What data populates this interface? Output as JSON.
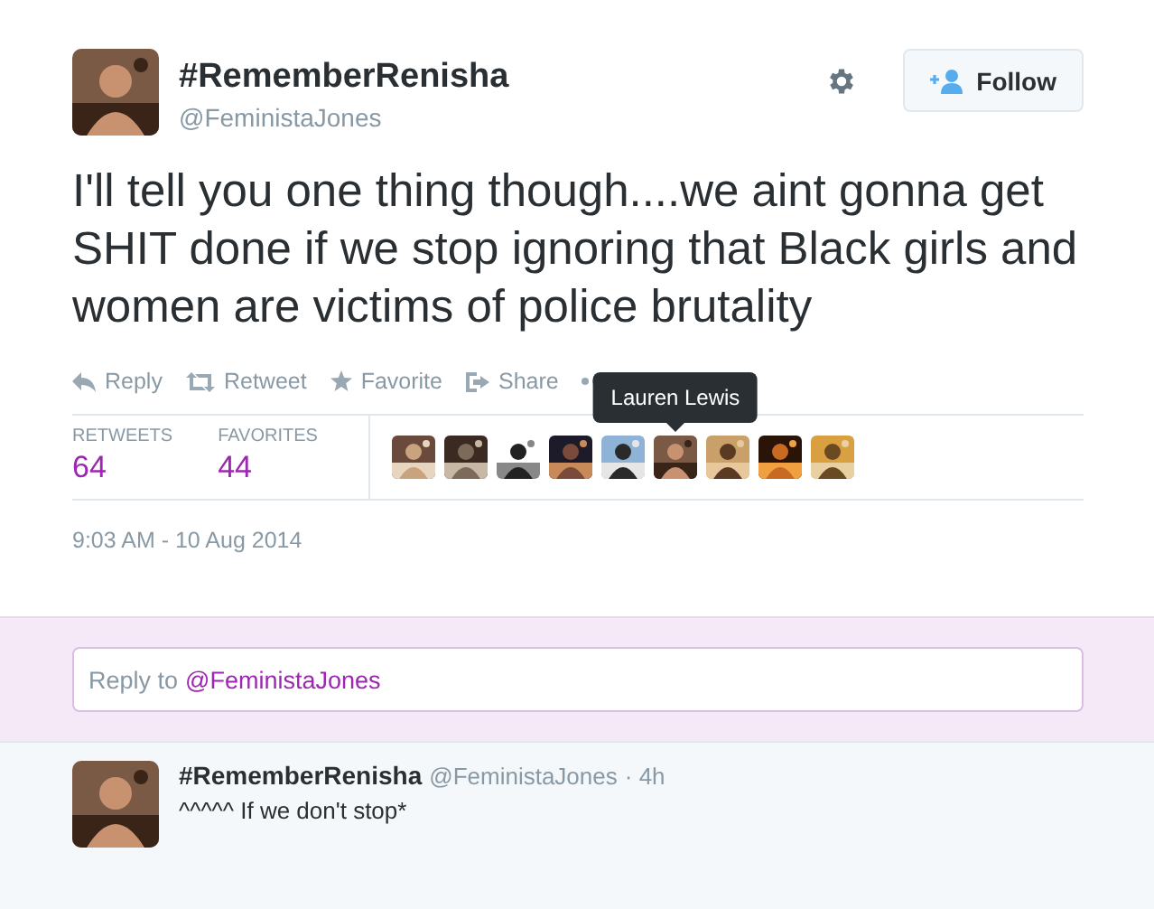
{
  "tweet": {
    "name": "#RememberRenisha",
    "handle": "@FeministaJones",
    "follow_label": "Follow",
    "text": "I'll tell you one thing though....we aint gonna get SHIT done if we stop ignoring that Black girls and women are victims of police brutality",
    "actions": [
      {
        "kind": "reply",
        "label": "Reply"
      },
      {
        "kind": "retweet",
        "label": "Retweet"
      },
      {
        "kind": "favorite",
        "label": "Favorite"
      },
      {
        "kind": "share",
        "label": "Share"
      },
      {
        "kind": "more"
      }
    ],
    "stats": [
      {
        "label": "RETWEETS",
        "value": "64"
      },
      {
        "label": "FAVORITES",
        "value": "44"
      }
    ],
    "favoriters": [
      {
        "kind": "picture"
      },
      {
        "kind": "picture"
      },
      {
        "kind": "picture"
      },
      {
        "kind": "picture"
      },
      {
        "kind": "picture"
      },
      {
        "kind": "picture",
        "tooltip": "Lauren Lewis"
      },
      {
        "kind": "picture"
      },
      {
        "kind": "picture"
      },
      {
        "kind": "picture"
      }
    ],
    "timestamp": "9:03 AM - 10 Aug 2014"
  },
  "reply_box": {
    "placeholder": "Reply to",
    "mention": "@FeministaJones"
  },
  "replies": [
    {
      "name": "#RememberRenisha",
      "handle": "@FeministaJones",
      "time": "· 4h",
      "text": "^^^^^ If we don't stop*"
    }
  ]
}
